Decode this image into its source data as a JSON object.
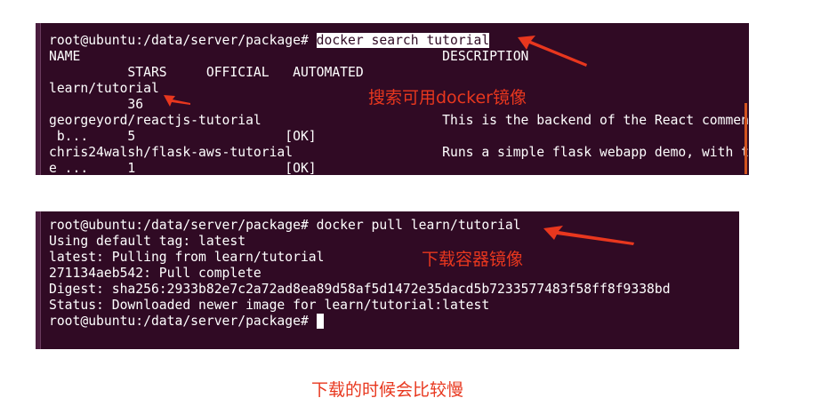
{
  "terminal1": {
    "lines": [
      "NAME                                              DESCRIPTION",
      "          STARS     OFFICIAL   AUTOMATED",
      "learn/tutorial",
      "          36",
      "georgeyord/reactjs-tutorial                       This is the backend of the React comment",
      " b...     5                   [OK]",
      "chris24walsh/flask-aws-tutorial                   Runs a simple flask webapp demo, with th",
      "e ...     1                   [OK]"
    ],
    "prompt": "root@ubuntu:/data/server/package# ",
    "command": "docker search tutorial"
  },
  "terminal2": {
    "lines": [
      "root@ubuntu:/data/server/package# docker pull learn/tutorial",
      "Using default tag: latest",
      "latest: Pulling from learn/tutorial",
      "271134aeb542: Pull complete",
      "Digest: sha256:2933b82e7c2a72ad8ea89d58af5d1472e35dacd5b7233577483f58ff8f9338bd",
      "Status: Downloaded newer image for learn/tutorial:latest"
    ],
    "prompt": "root@ubuntu:/data/server/package# "
  },
  "annotations": {
    "search": "搜索可用docker镜像",
    "pull": "下载容器镜像",
    "note": "下载的时候会比较慢"
  },
  "colors": {
    "terminal_bg": "#300a24",
    "annotation": "#e8371e"
  }
}
